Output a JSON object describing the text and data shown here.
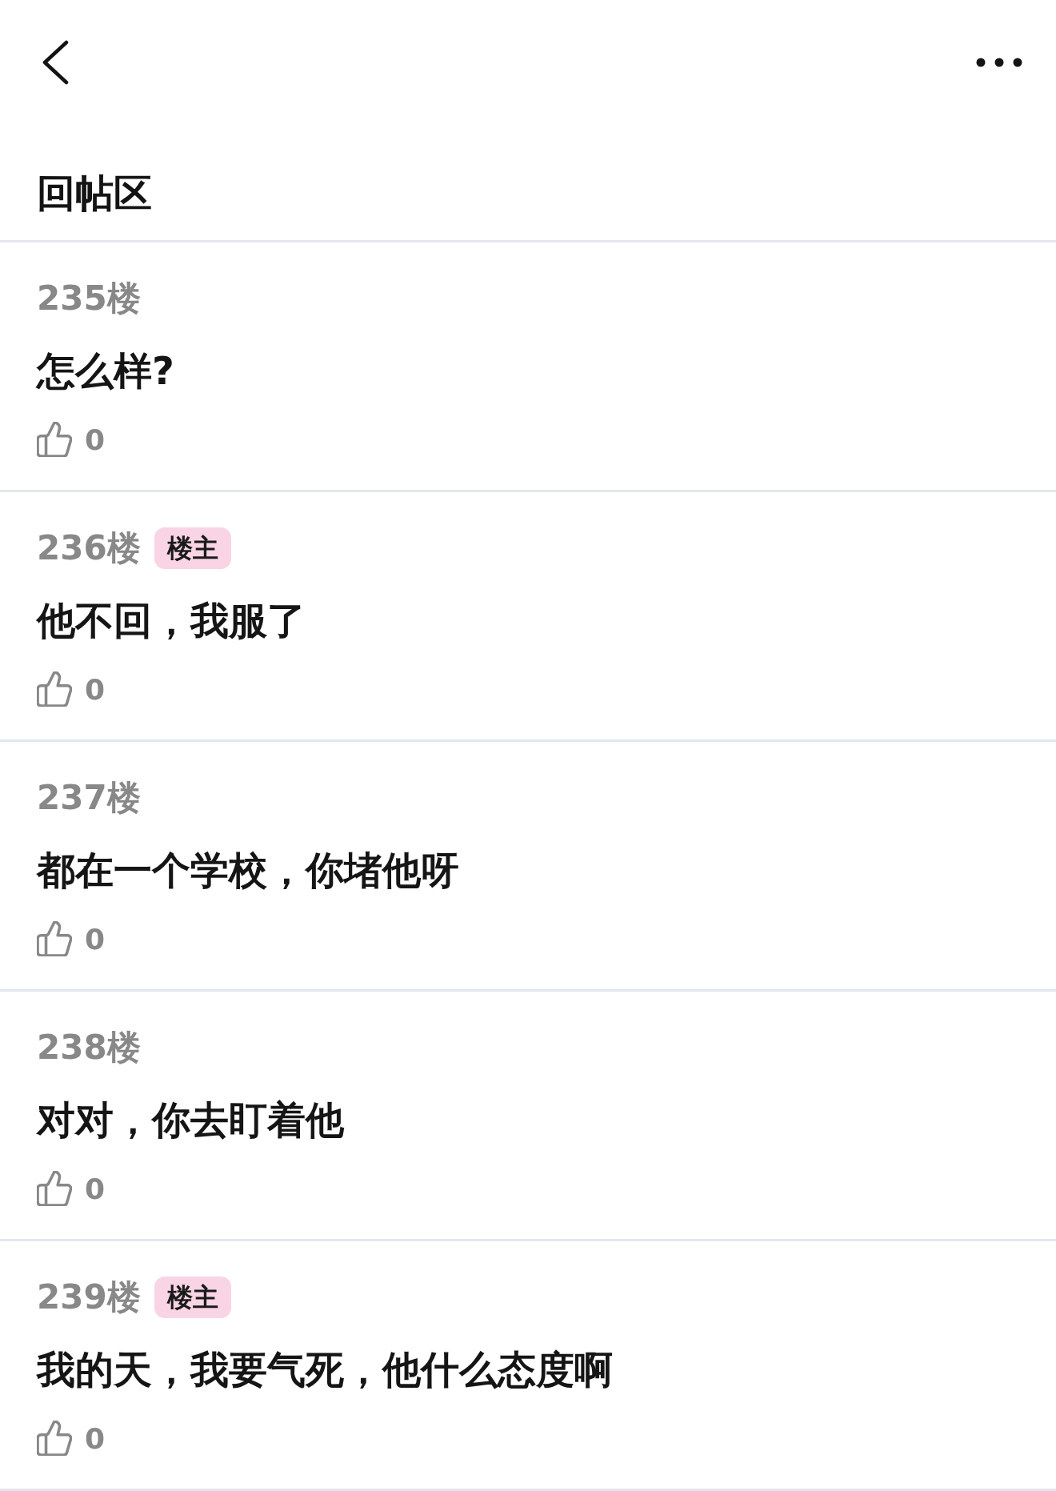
{
  "header": {
    "title": "回帖区"
  },
  "posts": [
    {
      "floor": "235楼",
      "content": "怎么样?",
      "likes": "0"
    },
    {
      "floor": "236楼",
      "badge": "楼主",
      "content": "他不回，我服了",
      "likes": "0"
    },
    {
      "floor": "237楼",
      "content": "都在一个学校，你堵他呀",
      "likes": "0"
    },
    {
      "floor": "238楼",
      "content": "对对，你去盯着他",
      "likes": "0"
    },
    {
      "floor": "239楼",
      "badge": "楼主",
      "content": "我的天，我要气死，他什么态度啊",
      "likes": "0"
    }
  ]
}
